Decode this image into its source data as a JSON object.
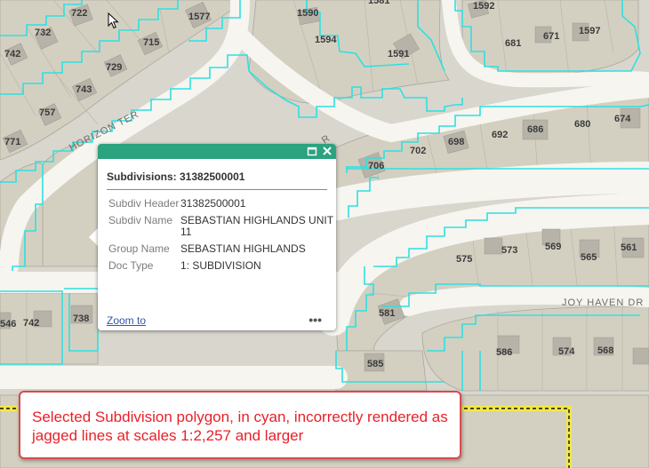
{
  "map": {
    "lot_numbers": [
      "722",
      "1577",
      "1590",
      "1581",
      "1592",
      "732",
      "742",
      "715",
      "1594",
      "681",
      "671",
      "1597",
      "729",
      "1591",
      "743",
      "757",
      "771",
      "680",
      "674",
      "698",
      "692",
      "686",
      "706",
      "702",
      "561",
      "575",
      "573",
      "569",
      "565",
      "581",
      "742",
      "738",
      "585",
      "586",
      "574",
      "568",
      "546"
    ],
    "streets": [
      "HORIZON TER",
      "JOY HAVEN DR"
    ]
  },
  "popup": {
    "title": "Subdivisions: 31382500001",
    "fields": [
      {
        "name": "Subdiv Header",
        "value": "31382500001"
      },
      {
        "name": "Subdiv Name",
        "value": "SEBASTIAN HIGHLANDS UNIT 11"
      },
      {
        "name": "Group Name",
        "value": "SEBASTIAN HIGHLANDS"
      },
      {
        "name": "Doc Type",
        "value": "1: SUBDIVISION"
      }
    ],
    "zoom_label": "Zoom to",
    "more_label": "•••"
  },
  "callout": {
    "text": "Selected Subdivision polygon, in cyan, incorrectly rendered as jagged lines at scales 1:2,257 and larger"
  },
  "colors": {
    "selection": "#2ee0e0",
    "parcel_fill": "#d4d0c1",
    "road": "#f7f6f2",
    "popup_header": "#2aa37e",
    "callout_border": "#d94a4f",
    "callout_text": "#e8212a"
  }
}
